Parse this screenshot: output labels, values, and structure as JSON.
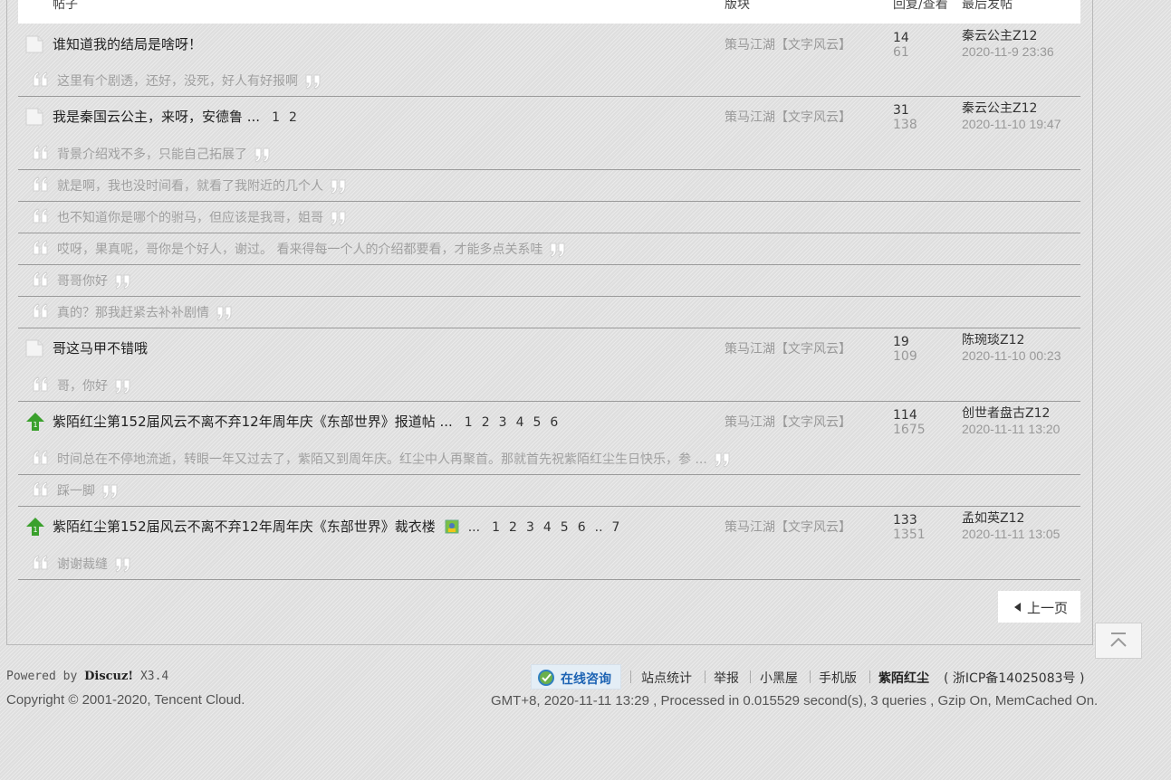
{
  "table_header": {
    "topic": "帖子",
    "forum": "版块",
    "replies_views": "回复/查看",
    "last_post": "最后发帖"
  },
  "threads": [
    {
      "title": "谁知道我的结局是啥呀！",
      "icon": "folder-icon",
      "pages": [],
      "forum": "策马江湖【文字风云】",
      "replies": "14",
      "views": "61",
      "last_author": "秦云公主Z12",
      "last_time": "2020-11-9 23:36",
      "quotes": [
        "这里有个剧透，还好，没死，好人有好报啊"
      ]
    },
    {
      "title": "我是秦国云公主，来呀，安德鲁 ...",
      "icon": "folder-icon",
      "pages": [
        "1",
        "2"
      ],
      "forum": "策马江湖【文字风云】",
      "replies": "31",
      "views": "138",
      "last_author": "秦云公主Z12",
      "last_time": "2020-11-10 19:47",
      "quotes": [
        "背景介绍戏不多，只能自己拓展了",
        "就是啊，我也没时间看，就看了我附近的几个人",
        "也不知道你是哪个的驸马，但应该是我哥，姐哥",
        "哎呀，果真呢，哥你是个好人，谢过。 看来得每一个人的介绍都要看，才能多点关系哇",
        "哥哥你好",
        "真的？那我赶紧去补补剧情"
      ]
    },
    {
      "title": "哥这马甲不错哦",
      "icon": "folder-icon",
      "pages": [],
      "forum": "策马江湖【文字风云】",
      "replies": "19",
      "views": "109",
      "last_author": "陈琬琰Z12",
      "last_time": "2020-11-10 00:23",
      "quotes": [
        "哥，你好"
      ]
    },
    {
      "title": "紫陌红尘第152届风云不离不弃12年周年庆《东部世界》报道帖 ...",
      "icon": "pinned-up-icon",
      "pages": [
        "1",
        "2",
        "3",
        "4",
        "5",
        "6"
      ],
      "forum": "策马江湖【文字风云】",
      "replies": "114",
      "views": "1675",
      "last_author": "创世者盘古Z12",
      "last_time": "2020-11-11 13:20",
      "quotes": [
        "时间总在不停地流逝，转眼一年又过去了，紫陌又到周年庆。红尘中人再聚首。那就首先祝紫陌红尘生日快乐，参 ...",
        "踩一脚"
      ]
    },
    {
      "title": "紫陌红尘第152届风云不离不弃12年周年庆《东部世界》裁衣楼",
      "icon": "pinned-up-icon",
      "has_image": true,
      "pages_prefix": "...",
      "pages": [
        "1",
        "2",
        "3",
        "4",
        "5",
        "6",
        "..",
        "7"
      ],
      "forum": "策马江湖【文字风云】",
      "replies": "133",
      "views": "1351",
      "last_author": "孟如英Z12",
      "last_time": "2020-11-11 13:05",
      "quotes": [
        "谢谢裁缝"
      ]
    }
  ],
  "pagination": {
    "prev_label": "上一页"
  },
  "footer": {
    "powered_prefix": "Powered by",
    "powered_brand": "Discuz!",
    "powered_version": "X3.4",
    "copyright": "Copyright © 2001-2020, Tencent Cloud.",
    "consult_label": "在线咨询",
    "links": [
      "站点统计",
      "举报",
      "小黑屋",
      "手机版"
    ],
    "site_name": "紫陌红尘",
    "icp": "( 浙ICP备14025083号 )",
    "gmt": "GMT+8, 2020-11-11 13:29 , Processed in 0.015529 second(s), 3 queries , Gzip On, MemCached On."
  },
  "colors": {
    "pinned_icon": "#3aa02c",
    "consult_text": "#1d63b3"
  }
}
